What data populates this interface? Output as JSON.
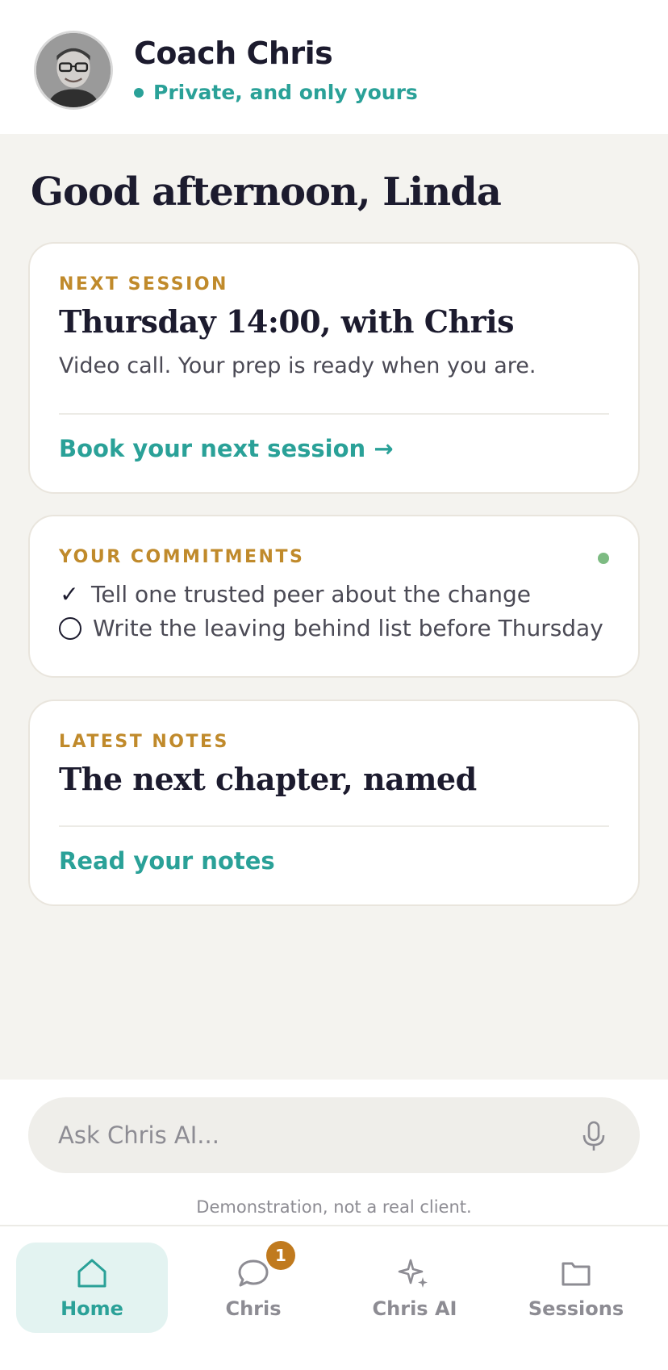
{
  "header": {
    "coach_name": "Coach Chris",
    "privacy_status": "Private, and only yours"
  },
  "greeting": "Good afternoon, Linda",
  "next_session": {
    "label": "NEXT SESSION",
    "title": "Thursday 14:00, with Chris",
    "subtitle": "Video call. Your prep is ready when you are.",
    "link": "Book your next session →"
  },
  "commitments": {
    "label": "YOUR COMMITMENTS",
    "items": [
      {
        "text": "Tell one trusted peer about the change",
        "done": true
      },
      {
        "text": "Write the leaving behind list before Thursday",
        "done": false
      }
    ]
  },
  "latest_notes": {
    "label": "LATEST NOTES",
    "title": "The next chapter, named",
    "link": "Read your notes"
  },
  "ask": {
    "placeholder": "Ask Chris AI..."
  },
  "disclaimer": "Demonstration, not a real client.",
  "nav": {
    "items": [
      {
        "label": "Home",
        "icon": "home-icon",
        "active": true
      },
      {
        "label": "Chris",
        "icon": "chat-bubble-icon",
        "badge": "1"
      },
      {
        "label": "Chris AI",
        "icon": "sparkle-icon"
      },
      {
        "label": "Sessions",
        "icon": "folder-icon"
      }
    ]
  },
  "colors": {
    "accent_teal": "#2aa198",
    "label_gold": "#c08a2b",
    "badge_orange": "#c07a1e",
    "status_green": "#7dbb82",
    "background": "#f4f3ef"
  }
}
